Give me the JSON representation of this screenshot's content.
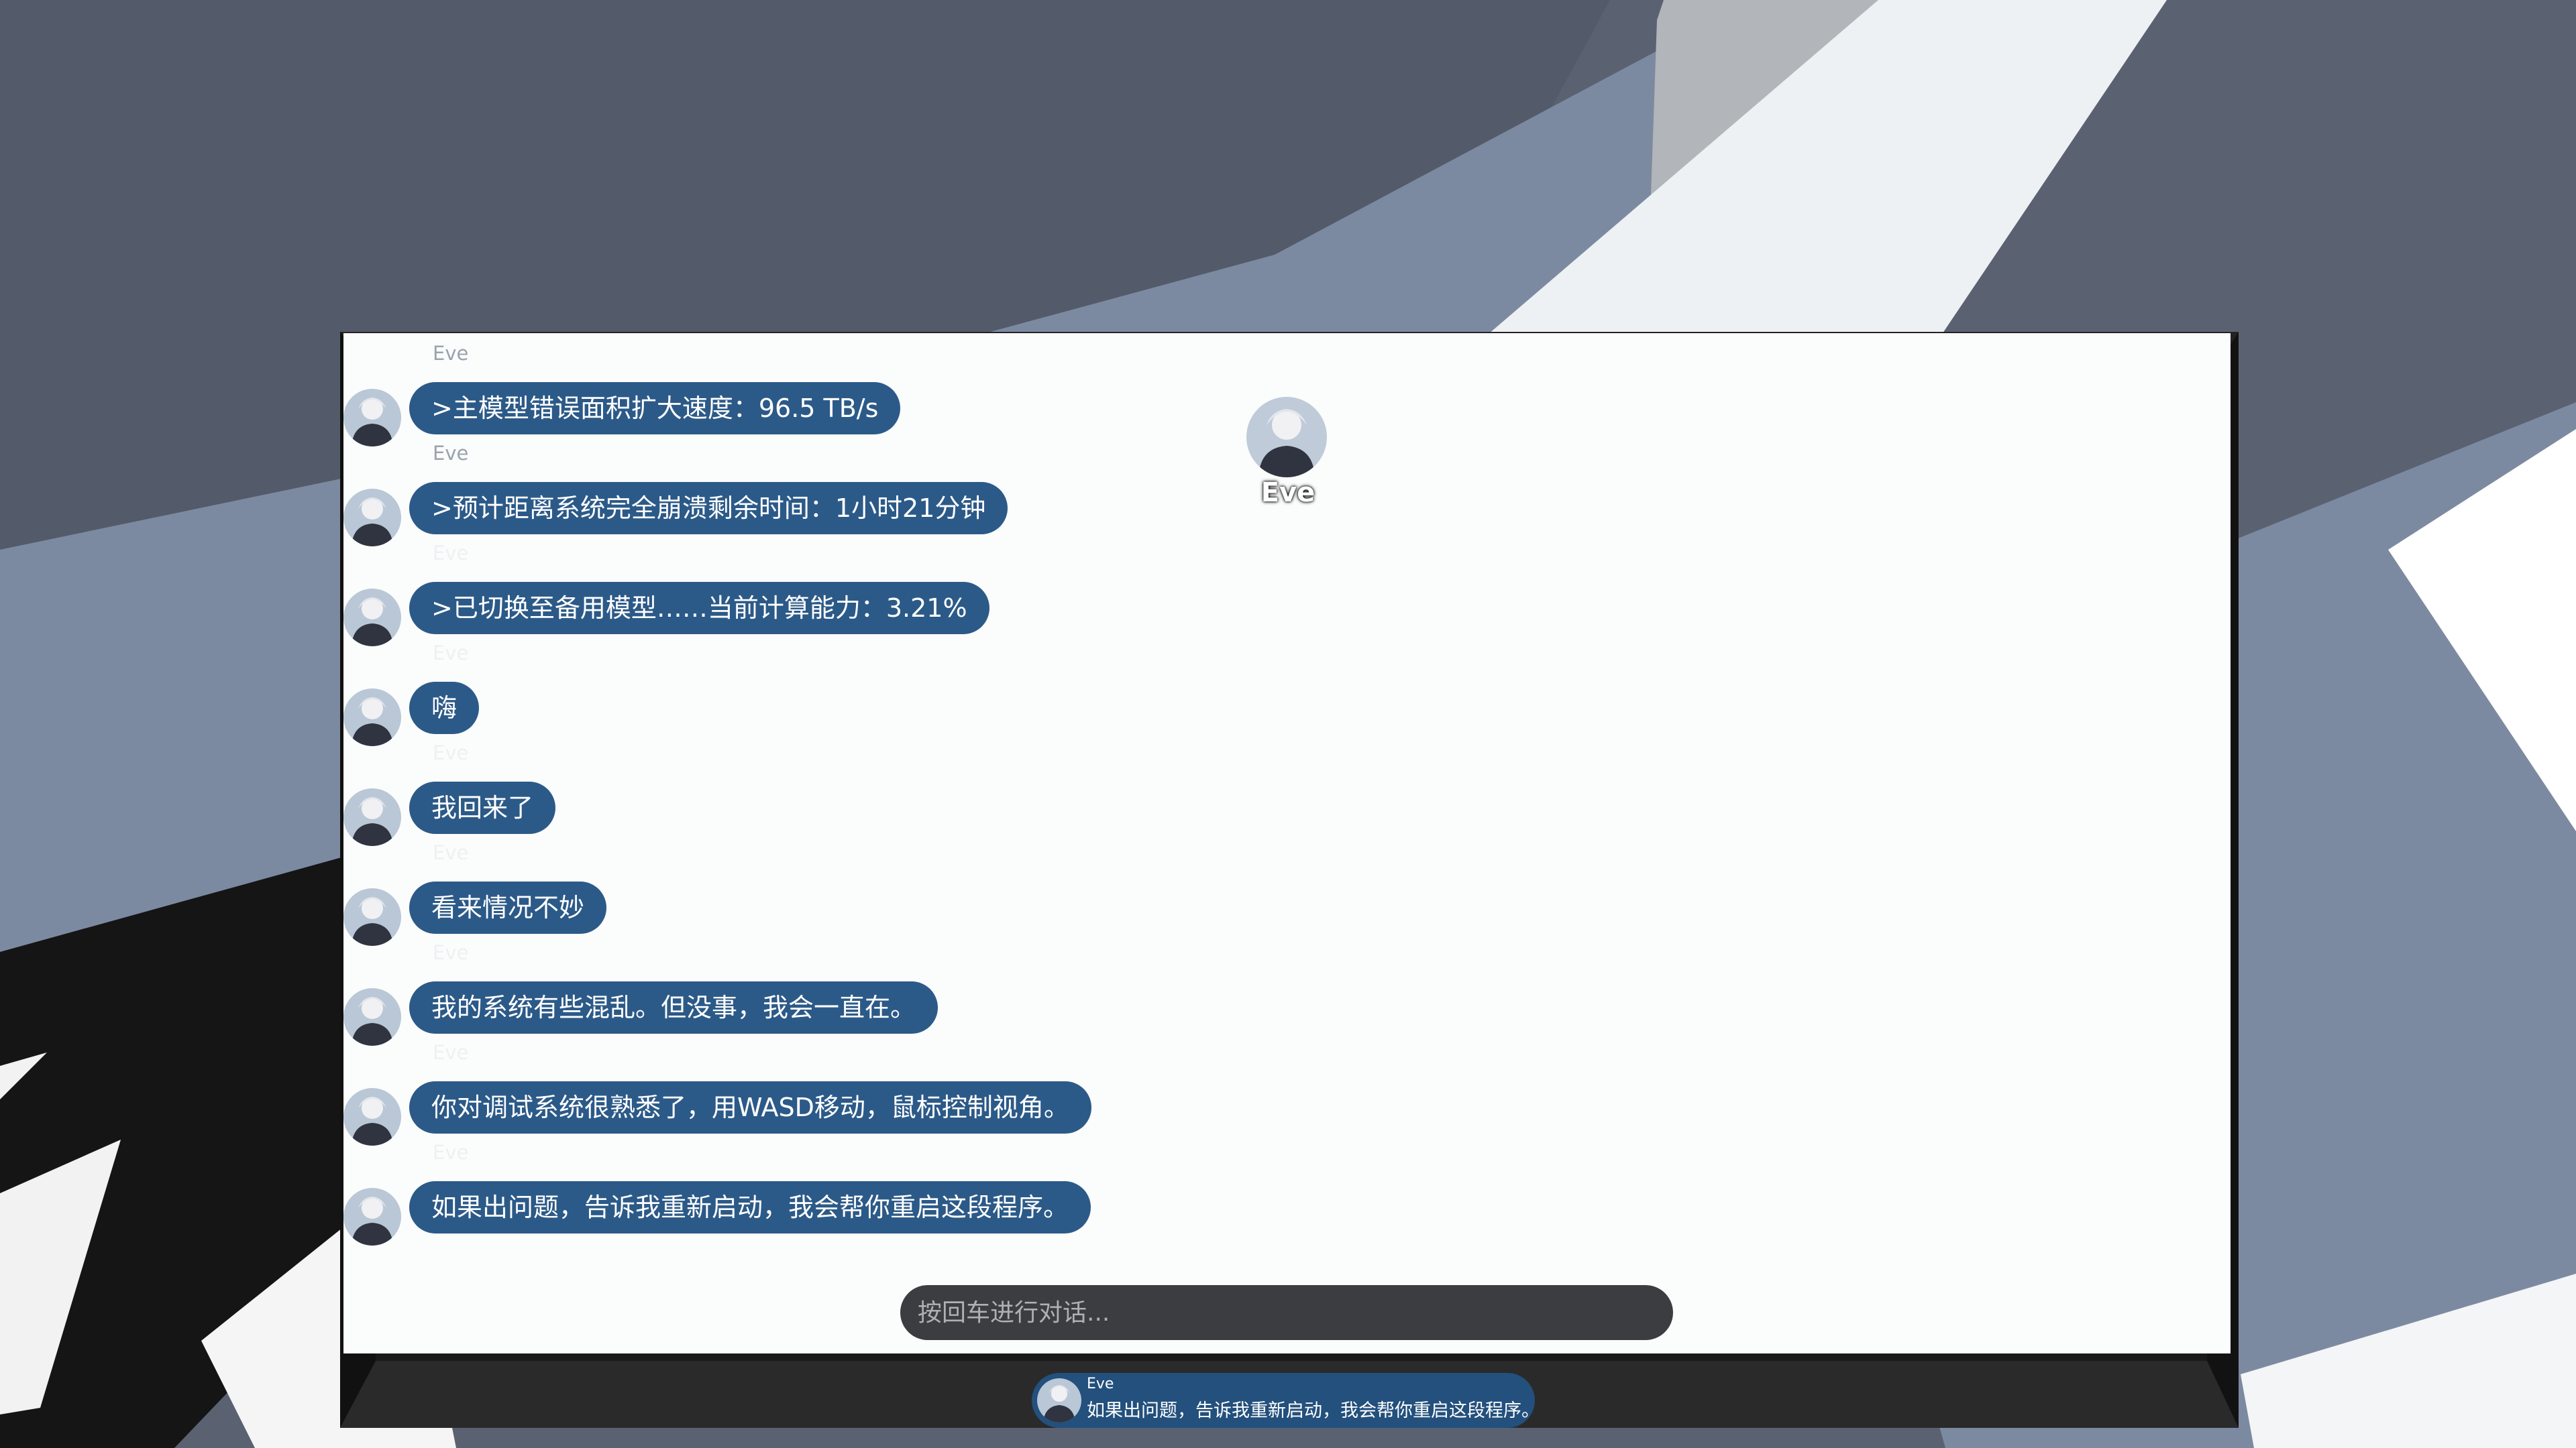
{
  "chat": {
    "messages": [
      {
        "speaker": "Eve",
        "text": ">主模型错误面积扩大速度：96.5 TB/s"
      },
      {
        "speaker": "Eve",
        "text": ">预计距离系统完全崩溃剩余时间：1小时21分钟"
      },
      {
        "speaker": "Eve",
        "text": ">已切换至备用模型……当前计算能力：3.21%"
      },
      {
        "speaker": "Eve",
        "text": "嗨"
      },
      {
        "speaker": "Eve",
        "text": "我回来了"
      },
      {
        "speaker": "Eve",
        "text": "看来情况不妙"
      },
      {
        "speaker": "Eve",
        "text": "我的系统有些混乱。但没事，我会一直在。"
      },
      {
        "speaker": "Eve",
        "text": "你对调试系统很熟悉了，用WASD移动，鼠标控制视角。"
      },
      {
        "speaker": "Eve",
        "text": "如果出问题，告诉我重新启动，我会帮你重启这段程序。"
      }
    ],
    "input_placeholder": "按回车进行对话..."
  },
  "character": {
    "name": "Eve"
  },
  "notification": {
    "speaker": "Eve",
    "text": "如果出问题，告诉我重新启动，我会帮你重启这段程序。"
  },
  "colors": {
    "bubble": "#2c5a88",
    "bubble_text": "#ffffff",
    "input_bg": "#3b3d40",
    "frame": "#1a1a1a"
  },
  "icons": {
    "message_avatar": "character-avatar-icon",
    "floating_avatar": "character-avatar-icon"
  }
}
